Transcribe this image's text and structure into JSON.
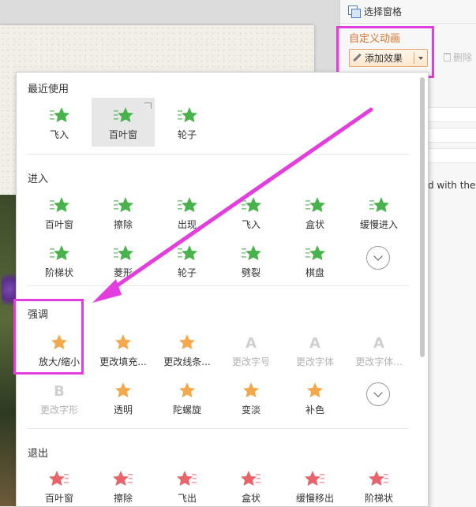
{
  "pane": {
    "select_window_label": "选择窗格",
    "custom_animation_title": "自定义动画",
    "add_effect_label": "添加效果",
    "delete_label": "删除",
    "pane_text": "d with the"
  },
  "dropdown": {
    "recent": {
      "title": "最近使用",
      "items": [
        {
          "label": "飞入",
          "icon": "fly-in-icon",
          "color": "#47b34a"
        },
        {
          "label": "百叶窗",
          "icon": "blinds-icon",
          "color": "#47b34a",
          "selected": true
        },
        {
          "label": "轮子",
          "icon": "wheel-icon",
          "color": "#47b34a"
        }
      ]
    },
    "entrance": {
      "title": "进入",
      "row1": [
        {
          "label": "百叶窗",
          "icon": "blinds-icon"
        },
        {
          "label": "擦除",
          "icon": "wipe-icon"
        },
        {
          "label": "出现",
          "icon": "appear-icon"
        },
        {
          "label": "飞入",
          "icon": "fly-in-icon"
        },
        {
          "label": "盒状",
          "icon": "box-icon"
        },
        {
          "label": "缓慢进入",
          "icon": "crawl-in-icon"
        }
      ],
      "row2": [
        {
          "label": "阶梯状",
          "icon": "step-icon"
        },
        {
          "label": "菱形",
          "icon": "diamond-icon"
        },
        {
          "label": "轮子",
          "icon": "wheel-icon"
        },
        {
          "label": "劈裂",
          "icon": "split-icon"
        },
        {
          "label": "棋盘",
          "icon": "checkerboard-icon"
        }
      ]
    },
    "emphasis": {
      "title": "强调",
      "row1": [
        {
          "label": "放大/缩小",
          "icon": "grow-shrink-icon"
        },
        {
          "label": "更改填充...",
          "icon": "change-fill-icon"
        },
        {
          "label": "更改线条...",
          "icon": "change-line-icon"
        },
        {
          "label": "更改字号",
          "icon": "change-font-size-icon",
          "disabled": true
        },
        {
          "label": "更改字体",
          "icon": "change-font-icon",
          "disabled": true
        },
        {
          "label": "更改字体...",
          "icon": "change-font-color-icon",
          "disabled": true
        }
      ],
      "row2": [
        {
          "label": "更改字形",
          "icon": "change-font-style-icon",
          "disabled": true
        },
        {
          "label": "透明",
          "icon": "transparency-icon"
        },
        {
          "label": "陀螺旋",
          "icon": "spin-icon"
        },
        {
          "label": "变淡",
          "icon": "fade-icon"
        },
        {
          "label": "补色",
          "icon": "complementary-color-icon"
        }
      ]
    },
    "exit": {
      "title": "退出",
      "row1": [
        {
          "label": "百叶窗",
          "icon": "blinds-icon"
        },
        {
          "label": "擦除",
          "icon": "wipe-icon"
        },
        {
          "label": "飞出",
          "icon": "fly-out-icon"
        },
        {
          "label": "盒状",
          "icon": "box-icon"
        },
        {
          "label": "缓慢移出",
          "icon": "crawl-out-icon"
        },
        {
          "label": "阶梯状",
          "icon": "step-icon"
        }
      ]
    }
  },
  "colors": {
    "entrance_green": "#47b34a",
    "emphasis_orange": "#f5a84a",
    "exit_red": "#e9646a",
    "highlight_magenta": "#e33ddd",
    "accent_orange": "#d9732a"
  }
}
